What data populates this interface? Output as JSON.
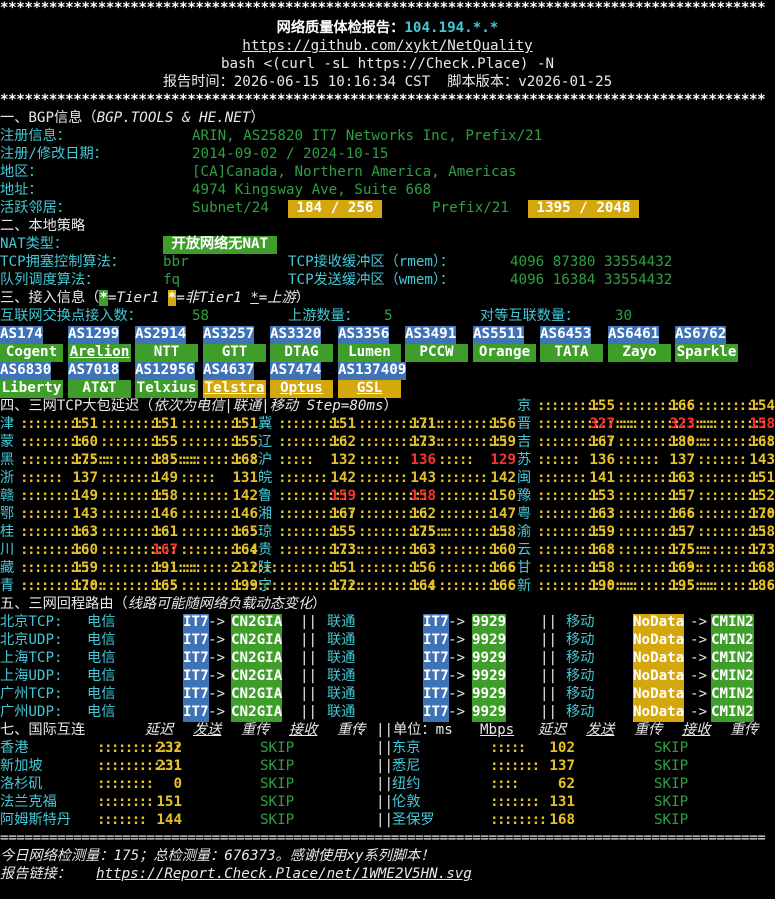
{
  "header": {
    "title_prefix": "网络质量体检报告：",
    "ip": "104.194.*.*",
    "repo_url": "https://github.com/xykt/NetQuality",
    "command": "bash <(curl -sL https://Check.Place) -N",
    "report_time_line": "报告时间：2026-06-15 10:16:34 CST  脚本版本：v2026-01-25"
  },
  "bgp": {
    "heading": "一、BGP信息（",
    "heading_source": "BGP.TOOLS & HE.NET",
    "heading_end": "）",
    "rows": [
      {
        "label": "注册信息：",
        "value": "ARIN, AS25820 IT7 Networks Inc, Prefix/21"
      },
      {
        "label": "注册/修改日期：",
        "value": "2014-09-02 / 2024-10-15"
      },
      {
        "label": "地区：",
        "value": "[CA]Canada, Northern America, Americas"
      },
      {
        "label": "地址：",
        "value": "4974 Kingsway Ave, Suite 668"
      }
    ],
    "neighbors_label": "活跃邻居：",
    "subnet_label": "Subnet/24",
    "subnet_value": " 184 / 256 ",
    "prefix_label": "Prefix/21",
    "prefix_value": " 1395 / 2048 "
  },
  "local": {
    "heading": "二、本地策略",
    "nat_label": "NAT类型：",
    "nat_value": " 开放网络无NAT ",
    "tcp_cc_label": "TCP拥塞控制算法：",
    "tcp_cc_value": "bbr",
    "rmem_label": "TCP接收缓冲区（rmem）：",
    "rmem_value": "4096 87380 33554432",
    "qdisc_label": "队列调度算法：",
    "qdisc_value": "fq",
    "wmem_label": "TCP发送缓冲区（wmem）：",
    "wmem_value": "4096 16384 33554432"
  },
  "access": {
    "heading": "三、接入信息（",
    "legend_tier1": "=Tier1",
    "legend_nontier1": "=非Tier1",
    "legend_upstream": "=上游",
    "legend_end": "）",
    "ix_label": "互联网交换点接入数：",
    "ix_value": "58",
    "upstream_label": "上游数量：",
    "upstream_value": "5",
    "peers_label": "对等互联数量：",
    "peers_value": "30",
    "rows": [
      [
        {
          "asn": "AS174",
          "name": "Cogent",
          "name_style": "tg"
        },
        {
          "asn": "AS1299",
          "name": "Arelion",
          "name_style": "tg",
          "upstream": true
        },
        {
          "asn": "AS2914",
          "name": "NTT",
          "name_style": "tg"
        },
        {
          "asn": "AS3257",
          "name": "GTT",
          "name_style": "tg"
        },
        {
          "asn": "AS3320",
          "name": "DTAG",
          "name_style": "tg"
        },
        {
          "asn": "AS3356",
          "name": "Lumen",
          "name_style": "tg"
        },
        {
          "asn": "AS3491",
          "name": "PCCW",
          "name_style": "tg"
        },
        {
          "asn": "AS5511",
          "name": "Orange",
          "name_style": "tg"
        },
        {
          "asn": "AS6453",
          "name": "TATA",
          "name_style": "tg"
        },
        {
          "asn": "AS6461",
          "name": "Zayo",
          "name_style": "tg"
        },
        {
          "asn": "AS6762",
          "name": "Sparkle",
          "name_style": "tg"
        }
      ],
      [
        {
          "asn": "AS6830",
          "name": "Liberty",
          "name_style": "tg"
        },
        {
          "asn": "AS7018",
          "name": "AT&T",
          "name_style": "tg"
        },
        {
          "asn": "AS12956",
          "name": "Telxius",
          "name_style": "tg"
        },
        {
          "asn": "AS4637",
          "name": "Telstra",
          "name_style": "ty",
          "upstream": true
        },
        {
          "asn": "AS7474",
          "name": "Optus",
          "name_style": "ty",
          "upstream": true
        },
        {
          "asn": "AS137409",
          "name": "GSL",
          "name_style": "ty",
          "upstream": true
        }
      ]
    ]
  },
  "latency": {
    "heading": "四、三网TCP大包延迟（",
    "heading_it": "依次为电信|联通|移动 Step=80ms",
    "heading_end": "）",
    "rows": [
      [
        {
          "p": "京",
          "v": [
            "155",
            "166",
            "154"
          ]
        }
      ],
      [
        {
          "p": "津",
          "v": [
            "151",
            "151",
            "151"
          ]
        },
        {
          "p": "冀",
          "v": [
            "151",
            "171",
            "156"
          ]
        },
        {
          "p": "晋",
          "v": [
            "327",
            "323",
            "158"
          ],
          "red": [
            0,
            1,
            2
          ]
        }
      ],
      [
        {
          "p": "蒙",
          "v": [
            "160",
            "155",
            "155"
          ]
        },
        {
          "p": "辽",
          "v": [
            "162",
            "173",
            "159"
          ]
        },
        {
          "p": "吉",
          "v": [
            "167",
            "180",
            "168"
          ]
        }
      ],
      [
        {
          "p": "黑",
          "v": [
            "175",
            "185",
            "168"
          ]
        },
        {
          "p": "沪",
          "v": [
            "132",
            "136",
            "129"
          ],
          "red": [
            1,
            2
          ]
        },
        {
          "p": "苏",
          "v": [
            "136",
            "137",
            "143"
          ]
        }
      ],
      [
        {
          "p": "浙",
          "v": [
            "137",
            "149",
            "131"
          ]
        },
        {
          "p": "皖",
          "v": [
            "142",
            "143",
            "142"
          ]
        },
        {
          "p": "闽",
          "v": [
            "141",
            "163",
            "151"
          ]
        }
      ],
      [
        {
          "p": "赣",
          "v": [
            "149",
            "158",
            "142"
          ]
        },
        {
          "p": "鲁",
          "v": [
            "159",
            "158",
            "150"
          ],
          "red": [
            0,
            1
          ]
        },
        {
          "p": "豫",
          "v": [
            "153",
            "157",
            "152"
          ]
        }
      ],
      [
        {
          "p": "鄂",
          "v": [
            "143",
            "146",
            "146"
          ]
        },
        {
          "p": "湘",
          "v": [
            "167",
            "162",
            "147"
          ]
        },
        {
          "p": "粤",
          "v": [
            "163",
            "166",
            "170"
          ]
        }
      ],
      [
        {
          "p": "桂",
          "v": [
            "163",
            "161",
            "165"
          ]
        },
        {
          "p": "琼",
          "v": [
            "155",
            "175",
            "158"
          ]
        },
        {
          "p": "渝",
          "v": [
            "159",
            "157",
            "158"
          ]
        }
      ],
      [
        {
          "p": "川",
          "v": [
            "160",
            "167",
            "164"
          ],
          "red": [
            1
          ]
        },
        {
          "p": "贵",
          "v": [
            "173",
            "163",
            "160"
          ]
        },
        {
          "p": "云",
          "v": [
            "168",
            "175",
            "173"
          ]
        }
      ],
      [
        {
          "p": "藏",
          "v": [
            "159",
            "191",
            "212"
          ]
        },
        {
          "p": "陕",
          "v": [
            "151",
            "156",
            "166"
          ]
        },
        {
          "p": "甘",
          "v": [
            "158",
            "169",
            "168"
          ]
        }
      ],
      [
        {
          "p": "青",
          "v": [
            "170",
            "165",
            "199"
          ]
        },
        {
          "p": "宁",
          "v": [
            "172",
            "164",
            "166"
          ]
        },
        {
          "p": "新",
          "v": [
            "190",
            "195",
            "186"
          ]
        }
      ]
    ]
  },
  "route": {
    "heading": "五、三网回程路由（",
    "heading_note": "线路可能随网络负载动态变化",
    "heading_end": "）",
    "ct": "电信",
    "cu": "联通",
    "cm": "移动",
    "sep": "||",
    "arrow": "->",
    "rows": [
      {
        "city": "北京TCP:",
        "ct": [
          "IT7",
          "CN2GIA"
        ],
        "cu": [
          "IT7",
          "9929"
        ],
        "cm": [
          "NoData",
          "CMIN2"
        ]
      },
      {
        "city": "北京UDP:",
        "ct": [
          "IT7",
          "CN2GIA"
        ],
        "cu": [
          "IT7",
          "9929"
        ],
        "cm": [
          "NoData",
          "CMIN2"
        ]
      },
      {
        "city": "上海TCP:",
        "ct": [
          "IT7",
          "CN2GIA"
        ],
        "cu": [
          "IT7",
          "9929"
        ],
        "cm": [
          "NoData",
          "CMIN2"
        ]
      },
      {
        "city": "上海UDP:",
        "ct": [
          "IT7",
          "CN2GIA"
        ],
        "cu": [
          "IT7",
          "9929"
        ],
        "cm": [
          "NoData",
          "CMIN2"
        ]
      },
      {
        "city": "广州TCP:",
        "ct": [
          "IT7",
          "CN2GIA"
        ],
        "cu": [
          "IT7",
          "9929"
        ],
        "cm": [
          "NoData",
          "CMIN2"
        ]
      },
      {
        "city": "广州UDP:",
        "ct": [
          "IT7",
          "CN2GIA"
        ],
        "cu": [
          "IT7",
          "9929"
        ],
        "cm": [
          "NoData",
          "CMIN2"
        ]
      }
    ]
  },
  "intl": {
    "heading": "七、国际互连",
    "col_latency": "延迟",
    "col_send": "发送",
    "col_retrans": "重传",
    "col_recv": "接收",
    "unit_label": "||单位：ms",
    "unit_mbps": "Mbps",
    "skip": "SKIP",
    "left": [
      {
        "city": "香港",
        "lat": "232"
      },
      {
        "city": "新加坡",
        "lat": "231"
      },
      {
        "city": "洛杉矶",
        "lat": "0"
      },
      {
        "city": "法兰克福",
        "lat": "151"
      },
      {
        "city": "阿姆斯特丹",
        "lat": "144"
      }
    ],
    "right": [
      {
        "city": "东京",
        "lat": "102"
      },
      {
        "city": "悉尼",
        "lat": "137"
      },
      {
        "city": "纽约",
        "lat": "62"
      },
      {
        "city": "伦敦",
        "lat": "131"
      },
      {
        "city": "圣保罗",
        "lat": "168"
      }
    ]
  },
  "footer": {
    "stats": "今日网络检测量：175；总检测量：676373。感谢使用xy系列脚本！",
    "link_label": "报告链接：",
    "link_url": "https://Report.Check.Place/net/1WME2V5HN.svg"
  },
  "colors": {
    "background": "#000000",
    "tier1": "#3f9e2a",
    "asn": "#3f73b8",
    "non_tier1": "#d4a80d",
    "latency_high": "#ff3131"
  }
}
